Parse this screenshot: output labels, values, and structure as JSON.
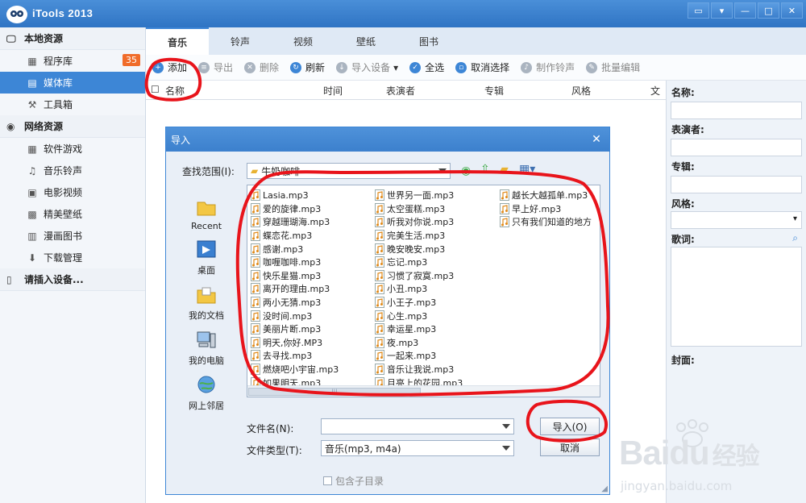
{
  "app": {
    "title": "iTools 2013"
  },
  "window_buttons": [
    "feedback-icon",
    "menu-icon",
    "minimize-icon",
    "maximize-icon",
    "close-icon"
  ],
  "sidebar": {
    "local_section": "本地资源",
    "local_items": [
      {
        "label": "程序库",
        "badge": "35",
        "icon": "apps-grid-icon"
      },
      {
        "label": "媒体库",
        "icon": "film-icon",
        "active": true
      },
      {
        "label": "工具箱",
        "icon": "wrench-icon"
      }
    ],
    "network_section": "网络资源",
    "network_items": [
      {
        "label": "软件游戏",
        "icon": "apps-grid-icon"
      },
      {
        "label": "音乐铃声",
        "icon": "music-note-icon"
      },
      {
        "label": "电影视频",
        "icon": "video-icon"
      },
      {
        "label": "精美壁纸",
        "icon": "image-icon"
      },
      {
        "label": "漫画图书",
        "icon": "book-icon"
      },
      {
        "label": "下载管理",
        "icon": "download-icon"
      }
    ],
    "device_section": "请插入设备..."
  },
  "tabs": [
    "音乐",
    "铃声",
    "视频",
    "壁纸",
    "图书"
  ],
  "toolbar": {
    "add": "添加",
    "export": "导出",
    "delete": "删除",
    "refresh": "刷新",
    "import_device": "导入设备",
    "select_all": "全选",
    "deselect": "取消选择",
    "make_ringtone": "制作铃声",
    "batch_edit": "批量编辑"
  },
  "columns": [
    "名称",
    "时间",
    "表演者",
    "专辑",
    "风格",
    "文"
  ],
  "right_panel": {
    "name": "名称:",
    "artist": "表演者:",
    "album": "专辑:",
    "genre": "风格:",
    "lyrics": "歌词:",
    "cover": "封面:"
  },
  "dialog": {
    "title": "导入",
    "look_in_label": "查找范围(I):",
    "look_in_value": "牛奶咖啡",
    "places": [
      "Recent",
      "桌面",
      "我的文档",
      "我的电脑",
      "网上邻居"
    ],
    "files_col1": [
      "Lasia.mp3",
      "爱的旋律.mp3",
      "穿越珊瑚海.mp3",
      "蝶恋花.mp3",
      "感谢.mp3",
      "咖喱咖啡.mp3",
      "快乐星猫.mp3",
      "离开的理由.mp3",
      "两小无猜.mp3",
      "没时间.mp3",
      "美丽片断.mp3",
      "明天,你好.MP3",
      "去寻找.mp3",
      "燃烧吧小宇宙.mp3",
      "如果明天.mp3"
    ],
    "files_col2": [
      "世界另一面.mp3",
      "太空蛋糕.mp3",
      "听我对你说.mp3",
      "完美生活.mp3",
      "晚安晚安.mp3",
      "忘记.mp3",
      "习惯了寂寞.mp3",
      "小丑.mp3",
      "小王子.mp3",
      "心生.mp3",
      "幸运星.mp3",
      "夜.mp3",
      "一起来.mp3",
      "音乐让我说.mp3",
      "月亮上的花园.mp3"
    ],
    "files_col3": [
      "越长大越孤单.mp3",
      "早上好.mp3",
      "只有我们知道的地方"
    ],
    "filename_label": "文件名(N):",
    "filename_value": "",
    "filetype_label": "文件类型(T):",
    "filetype_value": "音乐(mp3, m4a)",
    "import_button": "导入(O)",
    "cancel_button": "取消",
    "subdir_checkbox": "包含子目录"
  },
  "watermark": {
    "brand": "Bai",
    "brand2": "du",
    "cn": "经验",
    "url": "jingyan.baidu.com"
  },
  "colors": {
    "accent": "#3d86d6",
    "annotation": "#e8141b",
    "badge": "#f06c2a"
  }
}
